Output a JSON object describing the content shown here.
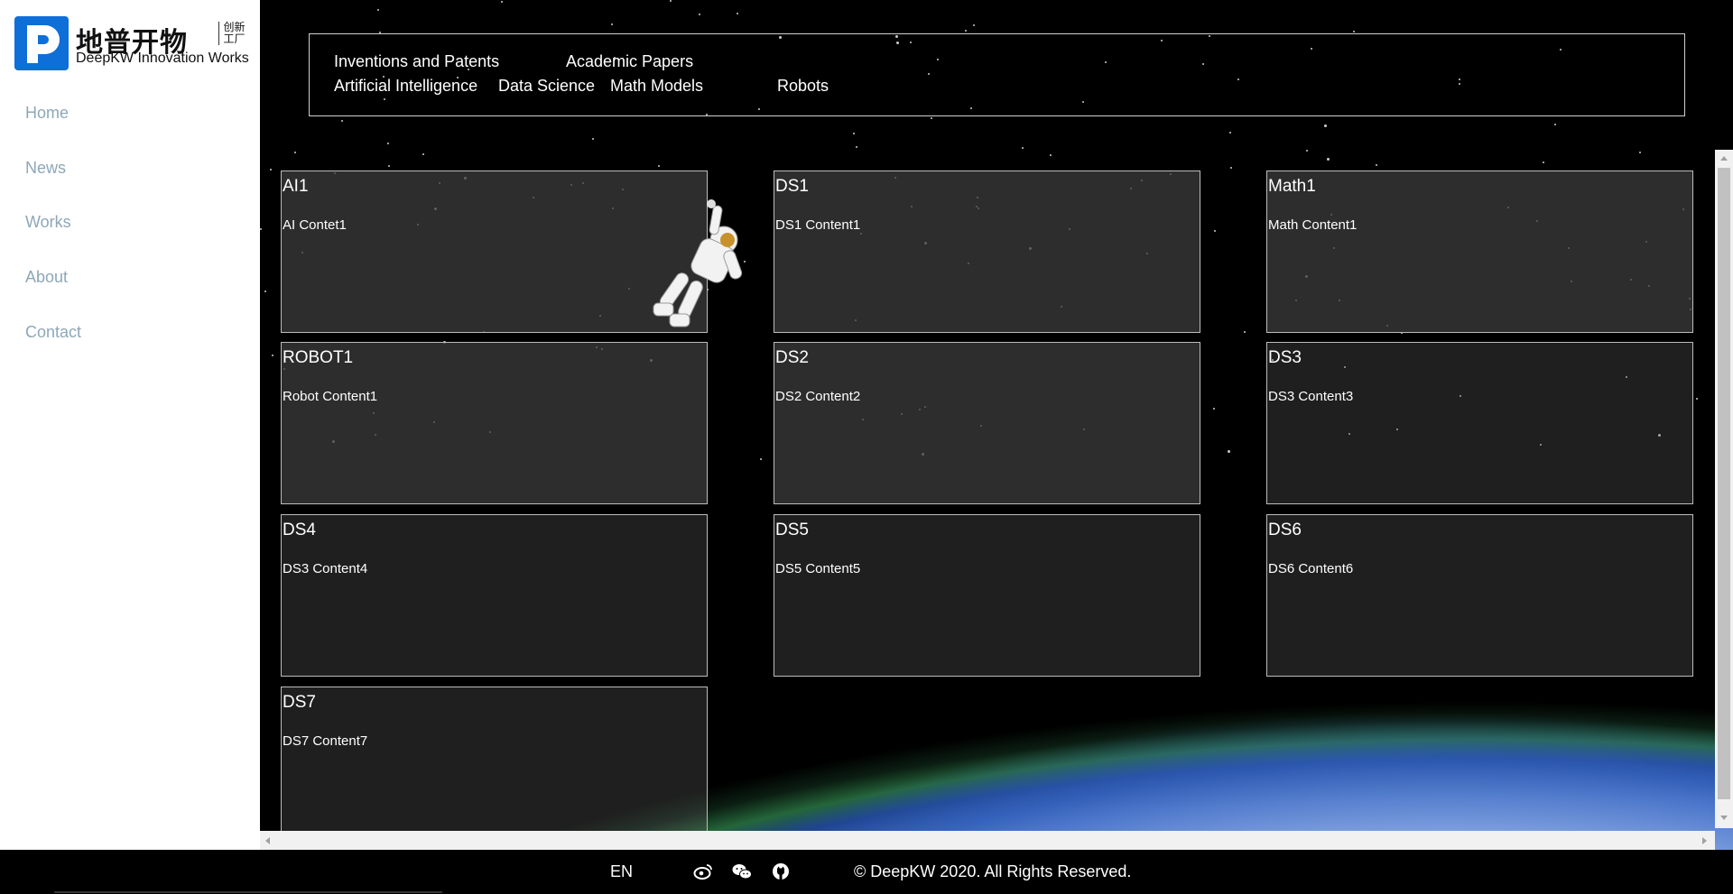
{
  "brand": {
    "name_cn": "地普开物",
    "sub_cn": "创新工厂",
    "name_en": "DeepKW Innovation Works",
    "accent": "#0e6fd8"
  },
  "sidebar": {
    "items": [
      {
        "label": "Home"
      },
      {
        "label": "News"
      },
      {
        "label": "Works"
      },
      {
        "label": "About"
      },
      {
        "label": "Contact"
      }
    ]
  },
  "topnav": {
    "row1": [
      "Inventions and Patents",
      "Academic Papers"
    ],
    "row2": [
      "Artificial Intelligence",
      "Data Science",
      "Math Models",
      "Robots"
    ]
  },
  "cards": [
    {
      "title": "AI1",
      "content": "AI Contet1"
    },
    {
      "title": "DS1",
      "content": "DS1 Content1"
    },
    {
      "title": "Math1",
      "content": "Math Content1"
    },
    {
      "title": "ROBOT1",
      "content": "Robot Content1"
    },
    {
      "title": "DS2",
      "content": "DS2 Content2"
    },
    {
      "title": "DS3",
      "content": "DS3 Content3"
    },
    {
      "title": "DS4",
      "content": "DS3 Content4"
    },
    {
      "title": "DS5",
      "content": "DS5 Content5"
    },
    {
      "title": "DS6",
      "content": "DS6 Content6"
    },
    {
      "title": "DS7",
      "content": "DS7 Content7"
    }
  ],
  "footer": {
    "lang": "EN",
    "social_icons": [
      "weibo-icon",
      "wechat-icon",
      "github-icon"
    ],
    "copyright": "© DeepKW 2020. All Rights Reserved."
  }
}
